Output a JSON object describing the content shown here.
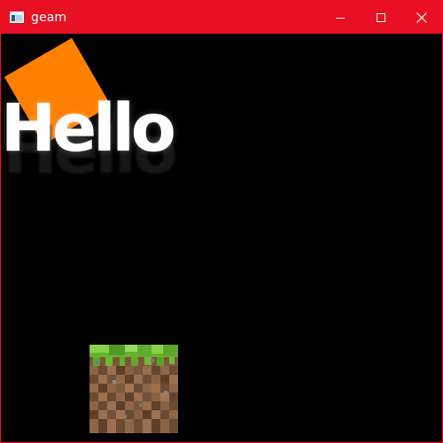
{
  "window": {
    "title": "geam",
    "accent_color": "#e81123",
    "icons": {
      "app": "app-window-icon",
      "minimize": "minimize-icon",
      "maximize": "maximize-icon",
      "close": "close-icon"
    }
  },
  "canvas": {
    "background": "#000000",
    "text": "Hello",
    "square_color": "#ff7f00",
    "block_icon": "grass-block-icon"
  }
}
